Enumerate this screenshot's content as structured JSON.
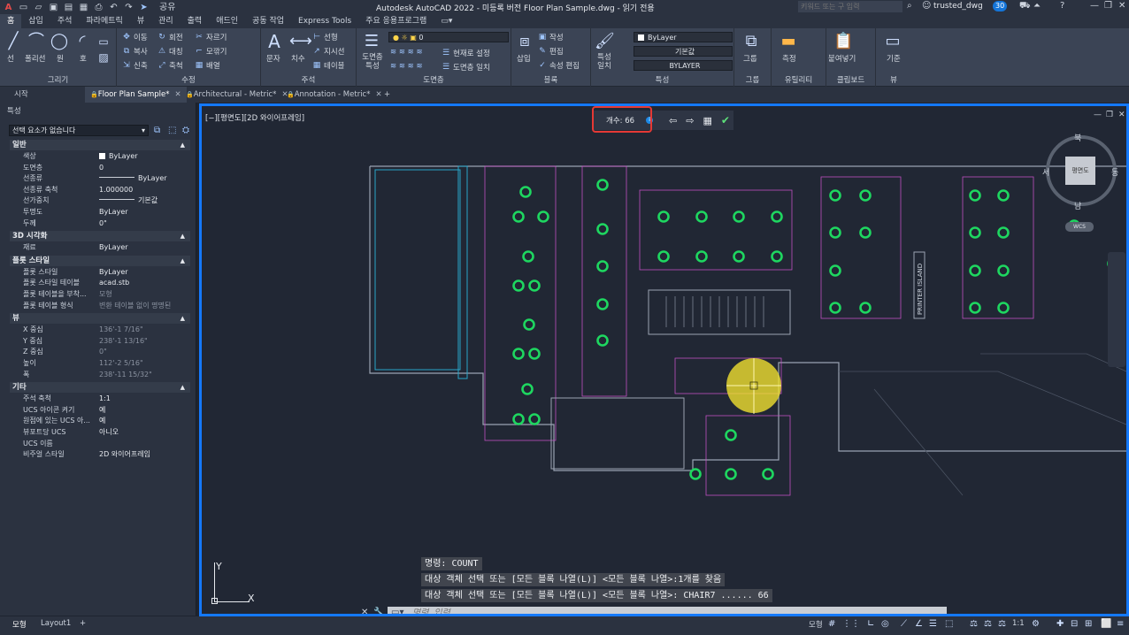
{
  "title_bar": {
    "qat_icons": [
      "app-menu-icon",
      "new-icon",
      "open-icon",
      "save-icon",
      "save-as-icon",
      "web-icon",
      "plot-icon",
      "undo-icon",
      "redo-icon",
      "share-icon"
    ],
    "share_label": "공유",
    "app_title": "Autodesk AutoCAD 2022 - 미등록 버전     Floor Plan Sample.dwg - 읽기 전용",
    "search_placeholder": "키워드 또는 구 입력",
    "user": "trusted_dwg",
    "badge": "30"
  },
  "menu": {
    "tabs": [
      "홈",
      "삽입",
      "주석",
      "파라메트릭",
      "뷰",
      "관리",
      "출력",
      "애드인",
      "공동 작업",
      "Express Tools",
      "주요 응용프로그램"
    ],
    "active": "홈"
  },
  "ribbon": {
    "draw": {
      "title": "그리기",
      "tools": [
        "선",
        "폴리선",
        "원",
        "호"
      ]
    },
    "modify": {
      "title": "수정",
      "tools": [
        "이동",
        "회전",
        "자르기",
        "복사",
        "대칭",
        "모깎기",
        "신축",
        "축척",
        "배열"
      ]
    },
    "annotation": {
      "title": "주석",
      "tools": [
        "문자",
        "치수",
        "선형",
        "지시선",
        "테이블"
      ]
    },
    "layers": {
      "title": "도면층",
      "big_label": "도면층 특성",
      "layer_value": "0",
      "tools": [
        "현재로 설정",
        "도면층 일치"
      ]
    },
    "block": {
      "title": "블록",
      "big_label": "삽입",
      "tools": [
        "작성",
        "편집",
        "속성 편집"
      ]
    },
    "properties": {
      "title": "특성",
      "big_label": "특성 일치",
      "color": "ByLayer",
      "lineweight": "기본값",
      "linetype": "BYLAYER"
    },
    "groups": {
      "title": "그룹",
      "big_label": "그룹"
    },
    "utilities": {
      "title": "유틸리티",
      "big_label": "측정"
    },
    "clipboard": {
      "title": "클립보드",
      "big_label": "붙여넣기"
    },
    "view": {
      "title": "뷰",
      "big_label": "기준"
    }
  },
  "doc_tabs": [
    {
      "label": "시작",
      "active": false,
      "closable": false
    },
    {
      "label": "Floor Plan Sample*",
      "active": true,
      "closable": true
    },
    {
      "label": "Architectural - Metric*",
      "active": false,
      "closable": true
    },
    {
      "label": "Annotation - Metric*",
      "active": false,
      "closable": true
    }
  ],
  "properties_palette": {
    "title": "특성",
    "selection": "선택 요소가 없습니다",
    "sections": [
      {
        "name": "일반",
        "rows": [
          {
            "k": "색상",
            "v": "ByLayer",
            "swatch": true
          },
          {
            "k": "도면층",
            "v": "0"
          },
          {
            "k": "선종류",
            "v": "ByLayer",
            "line": true
          },
          {
            "k": "선종류 축척",
            "v": "1.000000"
          },
          {
            "k": "선가중치",
            "v": "기본값",
            "line": true
          },
          {
            "k": "투명도",
            "v": "ByLayer"
          },
          {
            "k": "두께",
            "v": "0\""
          }
        ]
      },
      {
        "name": "3D 시각화",
        "rows": [
          {
            "k": "재료",
            "v": "ByLayer"
          }
        ]
      },
      {
        "name": "플롯 스타일",
        "rows": [
          {
            "k": "플롯 스타일",
            "v": "ByLayer"
          },
          {
            "k": "플롯 스타일 테이블",
            "v": "acad.stb"
          },
          {
            "k": "플롯 테이블을 부착...",
            "v": "모형",
            "dim": true
          },
          {
            "k": "플롯 테이블 형식",
            "v": "변환 테이블 없이 명명된",
            "dim": true
          }
        ]
      },
      {
        "name": "뷰",
        "rows": [
          {
            "k": "X 중심",
            "v": "136'-1 7/16\"",
            "dim": true
          },
          {
            "k": "Y 중심",
            "v": "238'-1 13/16\"",
            "dim": true
          },
          {
            "k": "Z 중심",
            "v": "0\"",
            "dim": true
          },
          {
            "k": "높이",
            "v": "112'-2 5/16\"",
            "dim": true
          },
          {
            "k": "폭",
            "v": "238'-11 15/32\"",
            "dim": true
          }
        ]
      },
      {
        "name": "기타",
        "rows": [
          {
            "k": "주석 축척",
            "v": "1:1"
          },
          {
            "k": "UCS 아이콘 켜기",
            "v": "예"
          },
          {
            "k": "원점에 있는 UCS 아...",
            "v": "예"
          },
          {
            "k": "뷰포트당 UCS",
            "v": "아니오"
          },
          {
            "k": "UCS 이름",
            "v": ""
          },
          {
            "k": "비주얼 스타일",
            "v": "2D 와이어프레임"
          }
        ]
      }
    ]
  },
  "viewport": {
    "label": "[−][평면도][2D 와이어프레임]",
    "count_label": "개수: 66",
    "room_label": "PRINTER ISLAND",
    "viewcube": {
      "face": "평면도",
      "north": "북",
      "south": "남",
      "east": "동",
      "west": "서",
      "wcs": "WCS"
    }
  },
  "command": {
    "history": [
      "명령: COUNT",
      "대상 객체 선택 또는 [모든 블록 나열(L)] <모든 블록 나열>:1개를 찾음",
      "대상 객체 선택 또는 [모든 블록 나열(L)] <모든 블록 나열>: CHAIR7 ...... 66"
    ],
    "input_placeholder": "명령 입력"
  },
  "ucs": {
    "x": "X",
    "y": "Y"
  },
  "layout_tabs": [
    "모형",
    "Layout1"
  ],
  "status": {
    "model": "모형",
    "scale": "1:1"
  },
  "colors": {
    "accent": "#1479ff",
    "highlight": "#e53935",
    "chair": "#1ed760",
    "cursor": "#f0e030"
  }
}
